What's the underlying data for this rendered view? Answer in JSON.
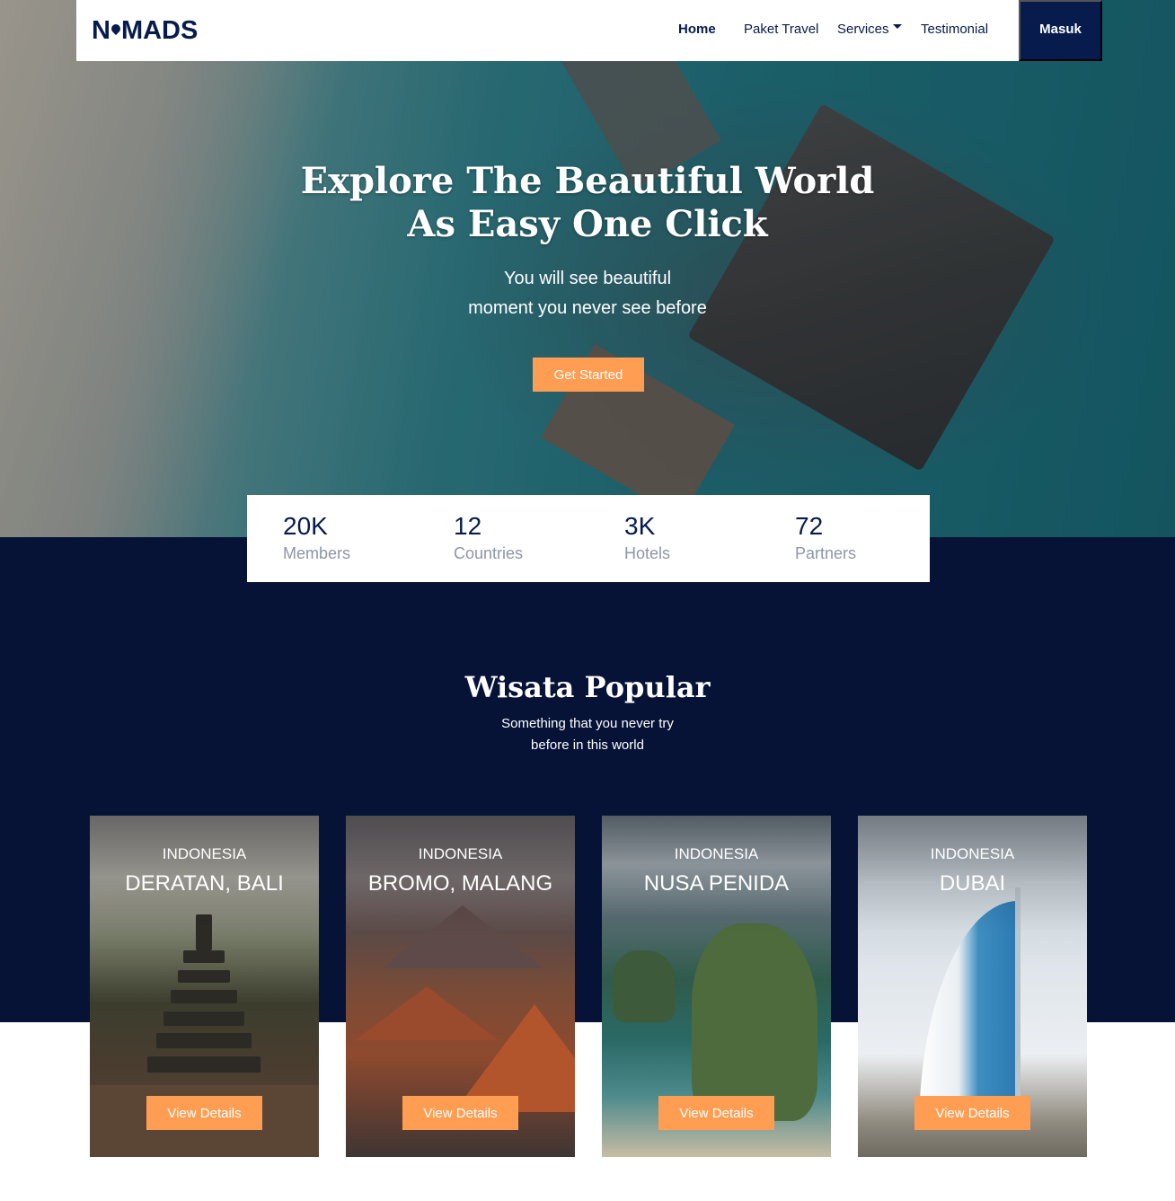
{
  "nav": {
    "logo": "N MADS",
    "links": [
      "Home",
      "Paket Travel",
      "Services",
      "Testimonial"
    ],
    "login": "Masuk"
  },
  "hero": {
    "title": "Explore The Beautiful World\nAs Easy One Click",
    "subtitle": "You will see beautiful\nmoment you never see before",
    "cta": "Get Started"
  },
  "stats": [
    {
      "value": "20K",
      "label": "Members"
    },
    {
      "value": "12",
      "label": "Countries"
    },
    {
      "value": "3K",
      "label": "Hotels"
    },
    {
      "value": "72",
      "label": "Partners"
    }
  ],
  "popular": {
    "title": "Wisata Popular",
    "subtitle": "Something that you never try\nbefore in this world",
    "cards": [
      {
        "country": "INDONESIA",
        "name": "DERATAN, BALI",
        "button": "View Details"
      },
      {
        "country": "INDONESIA",
        "name": "BROMO, MALANG",
        "button": "View Details"
      },
      {
        "country": "INDONESIA",
        "name": "NUSA PENIDA",
        "button": "View Details"
      },
      {
        "country": "INDONESIA",
        "name": "DUBAI",
        "button": "View Details"
      }
    ]
  },
  "colors": {
    "navy": "#071c4d",
    "dark_section": "#071336",
    "accent": "#ff9e53"
  }
}
